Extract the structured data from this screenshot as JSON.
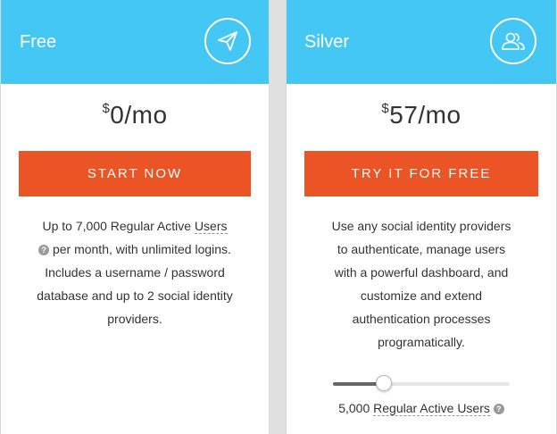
{
  "plans": [
    {
      "name": "Free",
      "icon": "paper-plane-icon",
      "price_currency": "$",
      "price_value": "0/mo",
      "cta_label": "START NOW",
      "description": {
        "part1": "Up to 7,000 Regular Active ",
        "term": "Users",
        "part2": " per month, with unlimited logins. Includes a username / password database and up to 2 social identity providers."
      }
    },
    {
      "name": "Silver",
      "icon": "users-icon",
      "price_currency": "$",
      "price_value": "57/mo",
      "cta_label": "TRY IT FOR FREE",
      "description": "Use any social identity providers to authenticate, manage users with a powerful dashboard, and customize and extend authentication processes programatically.",
      "users_slider": {
        "value_label_number": "5,000",
        "value_label_term": "Regular Active Users",
        "fill_fraction": 0.29
      }
    }
  ],
  "colors": {
    "header": "#44c7f4",
    "cta": "#eb5424"
  }
}
